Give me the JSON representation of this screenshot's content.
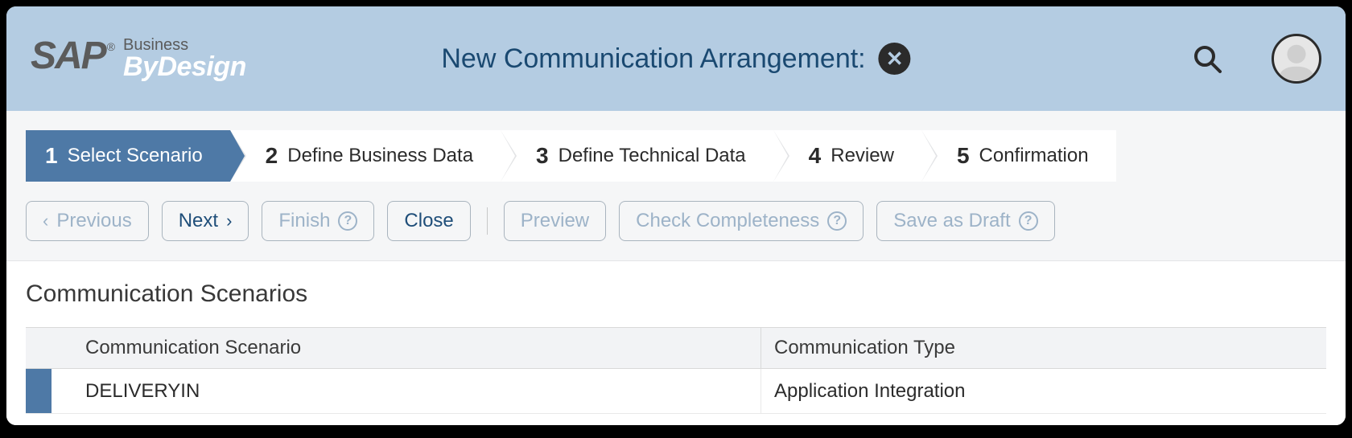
{
  "header": {
    "logo_brand": "SAP",
    "logo_reg": "®",
    "logo_line1": "Business",
    "logo_line2": "ByDesign",
    "title": "New Communication Arrangement:"
  },
  "steps": [
    {
      "num": "1",
      "label": "Select Scenario",
      "active": true
    },
    {
      "num": "2",
      "label": "Define Business Data",
      "active": false
    },
    {
      "num": "3",
      "label": "Define Technical Data",
      "active": false
    },
    {
      "num": "4",
      "label": "Review",
      "active": false
    },
    {
      "num": "5",
      "label": "Confirmation",
      "active": false
    }
  ],
  "toolbar": {
    "previous": "Previous",
    "next": "Next",
    "finish": "Finish",
    "close": "Close",
    "preview": "Preview",
    "check": "Check Completeness",
    "save_draft": "Save as Draft"
  },
  "section_title": "Communication Scenarios",
  "table": {
    "header_scenario": "Communication Scenario",
    "header_type": "Communication Type",
    "rows": [
      {
        "scenario": "DELIVERYIN",
        "type": "Application Integration",
        "selected": true
      }
    ]
  }
}
